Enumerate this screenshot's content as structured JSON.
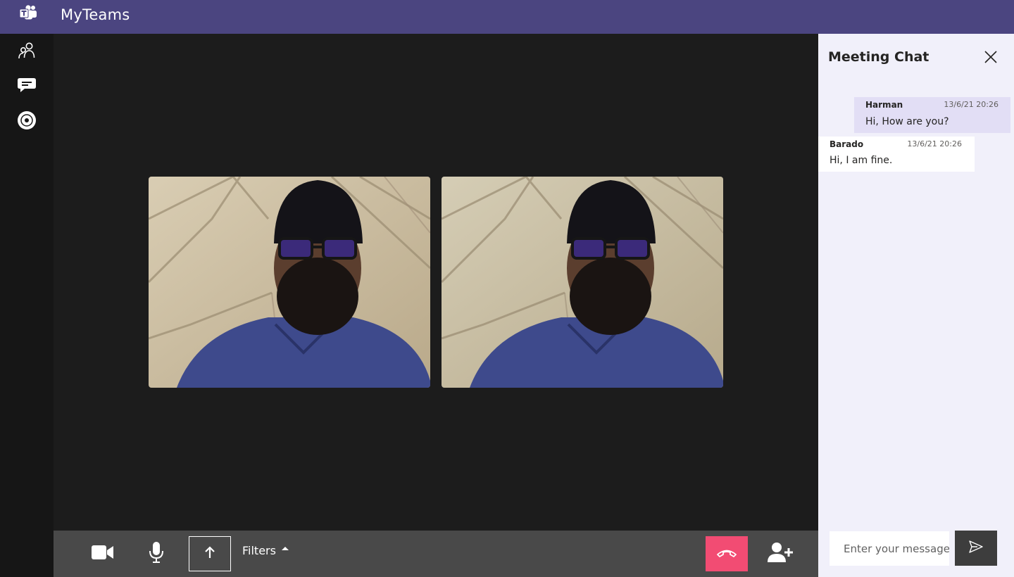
{
  "app": {
    "title": "MyTeams",
    "accent_color": "#4b4580",
    "logo_icon": "teams-logo-icon"
  },
  "sidebar": {
    "items": [
      {
        "id": "participants",
        "icon": "participants-icon"
      },
      {
        "id": "chat",
        "icon": "chat-bubble-icon"
      },
      {
        "id": "record",
        "icon": "record-icon"
      }
    ]
  },
  "stage": {
    "background": "#1c1c1c",
    "tiles": [
      {
        "id": "video-1",
        "kind": "participant-video"
      },
      {
        "id": "video-2",
        "kind": "participant-video"
      }
    ]
  },
  "controls": {
    "camera_icon": "video-camera-icon",
    "mic_icon": "microphone-icon",
    "share_icon": "arrow-up-icon",
    "filters_label": "Filters",
    "hangup_icon": "phone-hangup-icon",
    "hangup_color": "#f24c73",
    "add_participant_icon": "add-user-icon"
  },
  "chat": {
    "title": "Meeting Chat",
    "close_icon": "close-icon",
    "messages": [
      {
        "sender": "Harman",
        "time": "13/6/21 20:26",
        "text": "Hi, How are you?",
        "own": true
      },
      {
        "sender": "Barado",
        "time": "13/6/21 20:26",
        "text": "Hi, I am fine.",
        "own": false
      }
    ],
    "input": {
      "placeholder": "Enter your message",
      "value": ""
    },
    "send_icon": "send-icon"
  }
}
